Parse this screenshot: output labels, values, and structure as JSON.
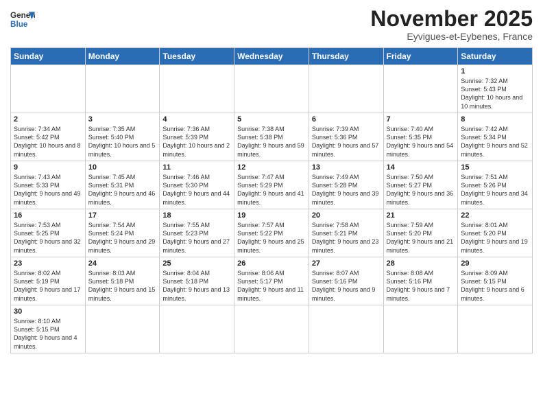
{
  "header": {
    "logo_general": "General",
    "logo_blue": "Blue",
    "month_title": "November 2025",
    "location": "Eyvigues-et-Eybenes, France"
  },
  "days_of_week": [
    "Sunday",
    "Monday",
    "Tuesday",
    "Wednesday",
    "Thursday",
    "Friday",
    "Saturday"
  ],
  "weeks": [
    [
      {
        "day": "",
        "info": ""
      },
      {
        "day": "",
        "info": ""
      },
      {
        "day": "",
        "info": ""
      },
      {
        "day": "",
        "info": ""
      },
      {
        "day": "",
        "info": ""
      },
      {
        "day": "",
        "info": ""
      },
      {
        "day": "1",
        "info": "Sunrise: 7:32 AM\nSunset: 5:43 PM\nDaylight: 10 hours and 10 minutes."
      }
    ],
    [
      {
        "day": "2",
        "info": "Sunrise: 7:34 AM\nSunset: 5:42 PM\nDaylight: 10 hours and 8 minutes."
      },
      {
        "day": "3",
        "info": "Sunrise: 7:35 AM\nSunset: 5:40 PM\nDaylight: 10 hours and 5 minutes."
      },
      {
        "day": "4",
        "info": "Sunrise: 7:36 AM\nSunset: 5:39 PM\nDaylight: 10 hours and 2 minutes."
      },
      {
        "day": "5",
        "info": "Sunrise: 7:38 AM\nSunset: 5:38 PM\nDaylight: 9 hours and 59 minutes."
      },
      {
        "day": "6",
        "info": "Sunrise: 7:39 AM\nSunset: 5:36 PM\nDaylight: 9 hours and 57 minutes."
      },
      {
        "day": "7",
        "info": "Sunrise: 7:40 AM\nSunset: 5:35 PM\nDaylight: 9 hours and 54 minutes."
      },
      {
        "day": "8",
        "info": "Sunrise: 7:42 AM\nSunset: 5:34 PM\nDaylight: 9 hours and 52 minutes."
      }
    ],
    [
      {
        "day": "9",
        "info": "Sunrise: 7:43 AM\nSunset: 5:33 PM\nDaylight: 9 hours and 49 minutes."
      },
      {
        "day": "10",
        "info": "Sunrise: 7:45 AM\nSunset: 5:31 PM\nDaylight: 9 hours and 46 minutes."
      },
      {
        "day": "11",
        "info": "Sunrise: 7:46 AM\nSunset: 5:30 PM\nDaylight: 9 hours and 44 minutes."
      },
      {
        "day": "12",
        "info": "Sunrise: 7:47 AM\nSunset: 5:29 PM\nDaylight: 9 hours and 41 minutes."
      },
      {
        "day": "13",
        "info": "Sunrise: 7:49 AM\nSunset: 5:28 PM\nDaylight: 9 hours and 39 minutes."
      },
      {
        "day": "14",
        "info": "Sunrise: 7:50 AM\nSunset: 5:27 PM\nDaylight: 9 hours and 36 minutes."
      },
      {
        "day": "15",
        "info": "Sunrise: 7:51 AM\nSunset: 5:26 PM\nDaylight: 9 hours and 34 minutes."
      }
    ],
    [
      {
        "day": "16",
        "info": "Sunrise: 7:53 AM\nSunset: 5:25 PM\nDaylight: 9 hours and 32 minutes."
      },
      {
        "day": "17",
        "info": "Sunrise: 7:54 AM\nSunset: 5:24 PM\nDaylight: 9 hours and 29 minutes."
      },
      {
        "day": "18",
        "info": "Sunrise: 7:55 AM\nSunset: 5:23 PM\nDaylight: 9 hours and 27 minutes."
      },
      {
        "day": "19",
        "info": "Sunrise: 7:57 AM\nSunset: 5:22 PM\nDaylight: 9 hours and 25 minutes."
      },
      {
        "day": "20",
        "info": "Sunrise: 7:58 AM\nSunset: 5:21 PM\nDaylight: 9 hours and 23 minutes."
      },
      {
        "day": "21",
        "info": "Sunrise: 7:59 AM\nSunset: 5:20 PM\nDaylight: 9 hours and 21 minutes."
      },
      {
        "day": "22",
        "info": "Sunrise: 8:01 AM\nSunset: 5:20 PM\nDaylight: 9 hours and 19 minutes."
      }
    ],
    [
      {
        "day": "23",
        "info": "Sunrise: 8:02 AM\nSunset: 5:19 PM\nDaylight: 9 hours and 17 minutes."
      },
      {
        "day": "24",
        "info": "Sunrise: 8:03 AM\nSunset: 5:18 PM\nDaylight: 9 hours and 15 minutes."
      },
      {
        "day": "25",
        "info": "Sunrise: 8:04 AM\nSunset: 5:18 PM\nDaylight: 9 hours and 13 minutes."
      },
      {
        "day": "26",
        "info": "Sunrise: 8:06 AM\nSunset: 5:17 PM\nDaylight: 9 hours and 11 minutes."
      },
      {
        "day": "27",
        "info": "Sunrise: 8:07 AM\nSunset: 5:16 PM\nDaylight: 9 hours and 9 minutes."
      },
      {
        "day": "28",
        "info": "Sunrise: 8:08 AM\nSunset: 5:16 PM\nDaylight: 9 hours and 7 minutes."
      },
      {
        "day": "29",
        "info": "Sunrise: 8:09 AM\nSunset: 5:15 PM\nDaylight: 9 hours and 6 minutes."
      }
    ],
    [
      {
        "day": "30",
        "info": "Sunrise: 8:10 AM\nSunset: 5:15 PM\nDaylight: 9 hours and 4 minutes."
      },
      {
        "day": "",
        "info": ""
      },
      {
        "day": "",
        "info": ""
      },
      {
        "day": "",
        "info": ""
      },
      {
        "day": "",
        "info": ""
      },
      {
        "day": "",
        "info": ""
      },
      {
        "day": "",
        "info": ""
      }
    ]
  ]
}
